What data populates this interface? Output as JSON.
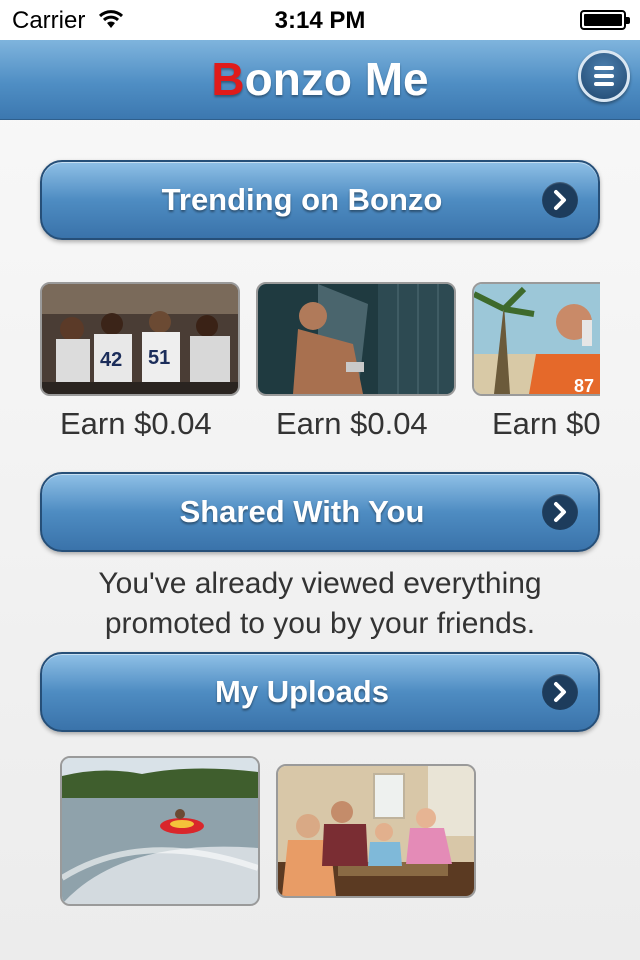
{
  "status_bar": {
    "carrier": "Carrier",
    "time": "3:14 PM"
  },
  "nav": {
    "title_first_letter": "B",
    "title_rest": "onzo Me"
  },
  "sections": {
    "trending": {
      "label": "Trending on Bonzo"
    },
    "shared": {
      "label": "Shared With You",
      "message_line1": "You've already viewed everything",
      "message_line2": "promoted to you by your friends."
    },
    "uploads": {
      "label": "My Uploads"
    }
  },
  "trending_items": [
    {
      "earn": "Earn $0.04",
      "scene": "football team in locker room"
    },
    {
      "earn": "Earn $0.04",
      "scene": "man in shower"
    },
    {
      "earn": "Earn $0",
      "scene": "football player drinking"
    }
  ],
  "upload_items": [
    {
      "scene": "tubing on lake"
    },
    {
      "scene": "family playing board game"
    }
  ],
  "icons": [
    "wifi-icon",
    "battery-icon",
    "menu-icon",
    "chevron-right-icon"
  ],
  "colors": {
    "brand_blue": "#4f8ec4",
    "brand_red": "#e01b1b",
    "nav_dark": "#1d3c5c"
  }
}
